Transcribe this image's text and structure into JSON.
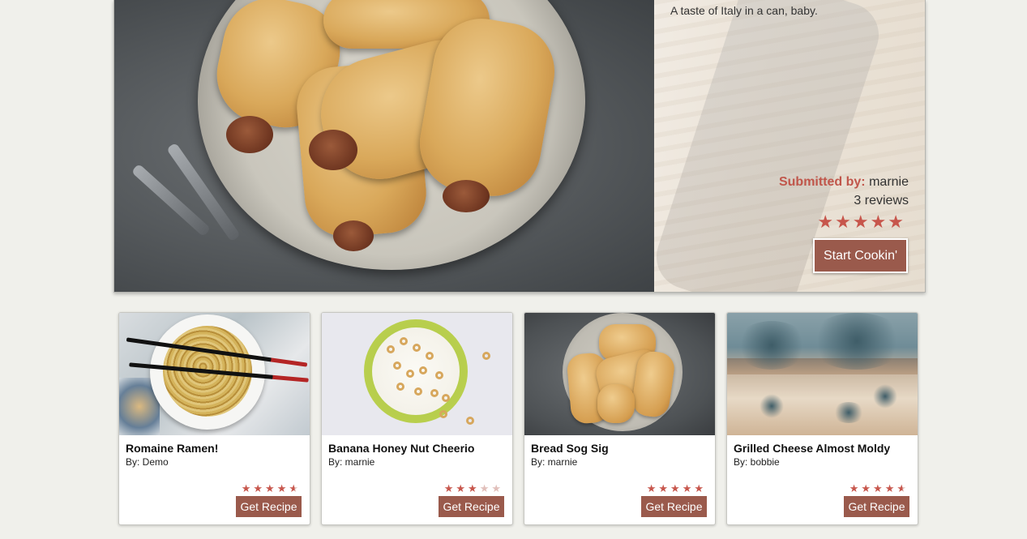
{
  "hero": {
    "description": "A taste of Italy in a can, baby.",
    "submitted_label": "Submitted by:",
    "submitted_user": "marnie",
    "reviews": "3 reviews",
    "rating": 5,
    "stars": "★★★★★",
    "button_label": "Start Cookin'"
  },
  "cards": [
    {
      "title": "Romaine Ramen!",
      "by": "By: Demo",
      "rating": 4.5,
      "button_label": "Get Recipe"
    },
    {
      "title": "Banana Honey Nut Cheerio",
      "by": "By: marnie",
      "rating": 3,
      "button_label": "Get Recipe"
    },
    {
      "title": "Bread Sog Sig",
      "by": "By: marnie",
      "rating": 5,
      "button_label": "Get Recipe"
    },
    {
      "title": "Grilled Cheese Almost Moldy",
      "by": "By: bobbie",
      "rating": 4.5,
      "button_label": "Get Recipe"
    }
  ],
  "colors": {
    "accent_star": "#c7564c",
    "button_brown": "#9a5a4c",
    "submitted_red": "#c0564b",
    "page_background": "#f0f0eb"
  },
  "icons": {
    "star": "star-icon"
  }
}
